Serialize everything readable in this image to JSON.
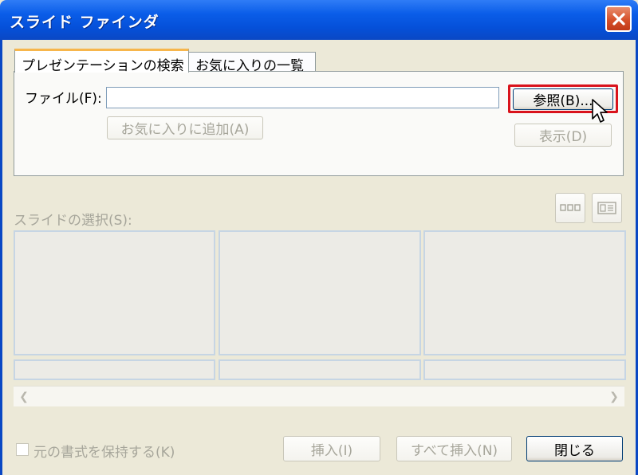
{
  "window": {
    "title": "スライド ファインダ"
  },
  "tabs": [
    {
      "label": "プレゼンテーションの検索"
    },
    {
      "label": "お気に入りの一覧"
    }
  ],
  "file": {
    "label": "ファイル(F):",
    "value": "",
    "placeholder": ""
  },
  "buttons": {
    "browse": "参照(B)...",
    "add_favorite": "お気に入りに追加(A)",
    "display": "表示(D)",
    "insert": "挿入(I)",
    "insert_all": "すべて挿入(N)",
    "close": "閉じる"
  },
  "slides": {
    "label": "スライドの選択(S):"
  },
  "options": {
    "keep_format_label": "元の書式を保持する(K)"
  },
  "icons": {
    "close": "close-icon",
    "view_thumbnails": "thumbnail-view-icon",
    "view_list": "list-view-icon",
    "cursor": "mouse-pointer-icon"
  },
  "colors": {
    "title_bar": "#0a5de8",
    "highlight": "#d9131c",
    "tab_accent": "#f7b64c"
  }
}
